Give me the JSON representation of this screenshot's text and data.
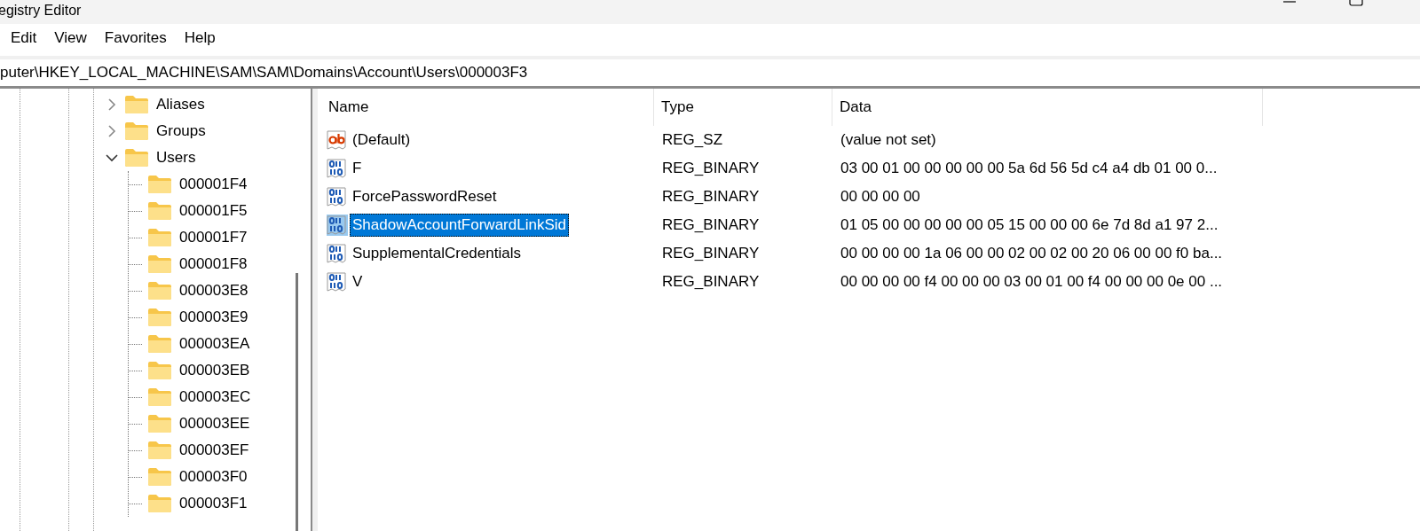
{
  "window": {
    "title": "egistry Editor"
  },
  "menu": [
    "Edit",
    "View",
    "Favorites",
    "Help"
  ],
  "address": "puter\\HKEY_LOCAL_MACHINE\\SAM\\SAM\\Domains\\Account\\Users\\000003F3",
  "tree": [
    {
      "label": "Aliases",
      "expanded": false
    },
    {
      "label": "Groups",
      "expanded": false
    },
    {
      "label": "Users",
      "expanded": true,
      "children": [
        {
          "label": "000001F4"
        },
        {
          "label": "000001F5"
        },
        {
          "label": "000001F7"
        },
        {
          "label": "000001F8"
        },
        {
          "label": "000003E8"
        },
        {
          "label": "000003E9"
        },
        {
          "label": "000003EA"
        },
        {
          "label": "000003EB"
        },
        {
          "label": "000003EC"
        },
        {
          "label": "000003EE"
        },
        {
          "label": "000003EF"
        },
        {
          "label": "000003F0"
        },
        {
          "label": "000003F1"
        }
      ]
    }
  ],
  "table": {
    "columns": [
      "Name",
      "Type",
      "Data"
    ],
    "rows": [
      {
        "kind": "string",
        "name": "(Default)",
        "type": "REG_SZ",
        "data": "(value not set)",
        "selected": false
      },
      {
        "kind": "binary",
        "name": "F",
        "type": "REG_BINARY",
        "data": "03 00 01 00 00 00 00 00 5a 6d 56 5d c4 a4 db 01 00 0...",
        "selected": false
      },
      {
        "kind": "binary",
        "name": "ForcePasswordReset",
        "type": "REG_BINARY",
        "data": "00 00 00 00",
        "selected": false
      },
      {
        "kind": "binary",
        "name": "ShadowAccountForwardLinkSid",
        "type": "REG_BINARY",
        "data": "01 05 00 00 00 00 00 05 15 00 00 00 6e 7d 8d a1 97 2...",
        "selected": true
      },
      {
        "kind": "binary",
        "name": "SupplementalCredentials",
        "type": "REG_BINARY",
        "data": "00 00 00 00 1a 06 00 00 02 00 02 00 20 06 00 00 f0 ba...",
        "selected": false
      },
      {
        "kind": "binary",
        "name": "V",
        "type": "REG_BINARY",
        "data": "00 00 00 00 f4 00 00 00 03 00 01 00 f4 00 00 00 0e 00 ...",
        "selected": false
      }
    ]
  }
}
